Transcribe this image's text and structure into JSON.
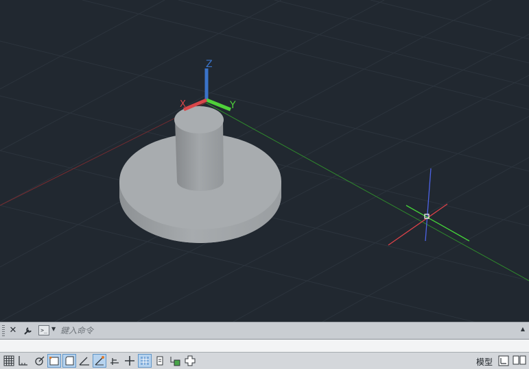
{
  "viewport": {
    "background": "#212830",
    "ucs_icon": {
      "z_label": "Z",
      "y_label": "Y",
      "x_label": "X",
      "x_color": "#d9474a",
      "y_color": "#4fd13a",
      "z_color": "#3a73c9"
    },
    "model": {
      "object": "cylinder-on-disc",
      "color": "#9da1a5"
    }
  },
  "command_line": {
    "placeholder": "鍵入命令",
    "prompt_glyph": ">_",
    "close_icon": "close-icon",
    "customize_icon": "wrench-icon"
  },
  "status_bar": {
    "model_tab_label": "模型",
    "toggles": [
      {
        "name": "grid-display",
        "icon": "grid-icon",
        "on": false
      },
      {
        "name": "snap-mode",
        "icon": "snap-icon",
        "on": false
      },
      {
        "name": "infer-constraints",
        "icon": "infer-icon",
        "on": false
      },
      {
        "name": "dynamic-input",
        "icon": "dynamic-input-icon",
        "on": true
      },
      {
        "name": "ortho-mode",
        "icon": "ortho-icon",
        "on": true
      },
      {
        "name": "polar-tracking",
        "icon": "polar-icon",
        "on": false
      },
      {
        "name": "object-snap",
        "icon": "osnap-icon",
        "on": true
      },
      {
        "name": "3d-object-snap",
        "icon": "3d-osnap-icon",
        "on": false
      },
      {
        "name": "object-snap-tracking",
        "icon": "otrack-icon",
        "on": false
      },
      {
        "name": "allow-disallow-ducs",
        "icon": "ducs-icon",
        "on": false
      },
      {
        "name": "show-hide-lineweight",
        "icon": "lineweight-icon",
        "on": true
      },
      {
        "name": "quick-properties",
        "icon": "quick-properties-icon",
        "on": false
      },
      {
        "name": "selection-cycling",
        "icon": "selection-cycling-icon",
        "on": false
      },
      {
        "name": "gizmo",
        "icon": "gizmo-icon",
        "on": false
      }
    ]
  }
}
